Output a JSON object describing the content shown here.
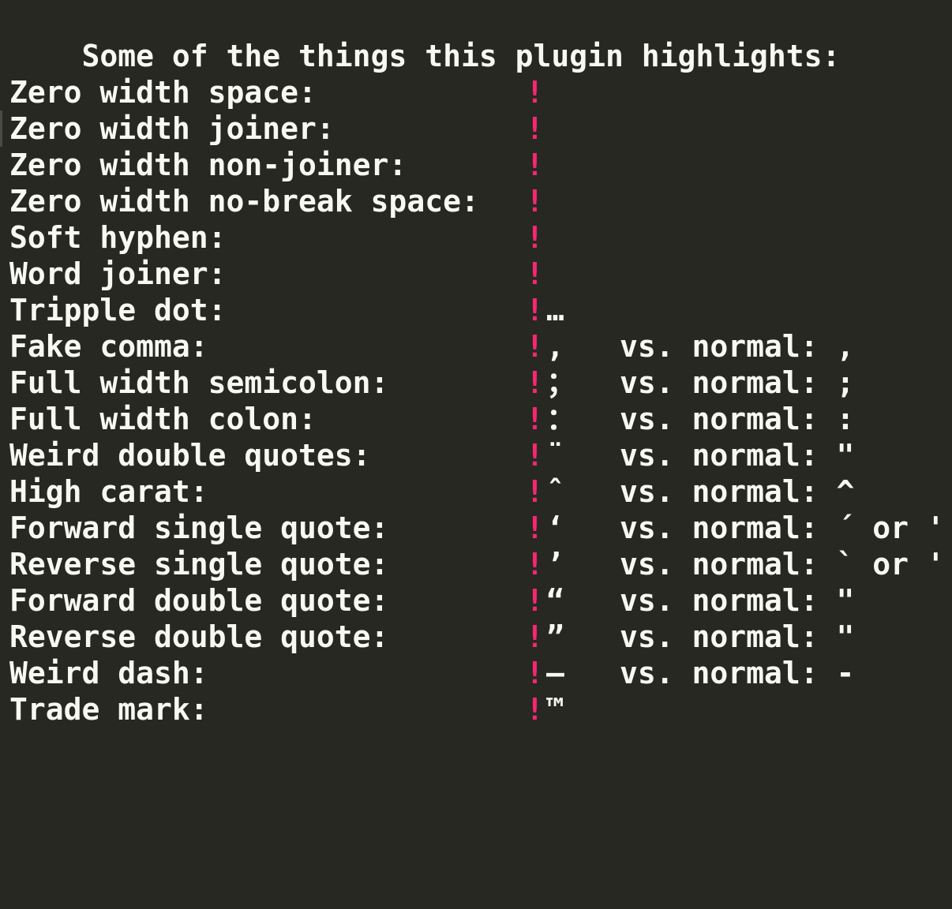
{
  "editor": {
    "heading": "Some of the things this plugin highlights:",
    "marker_color": "#f92672",
    "background_color": "#272822",
    "text_color": "#f8f8f2",
    "rows": [
      {
        "label": "Zero width space:",
        "marker": "!",
        "glyph": "",
        "compare": ""
      },
      {
        "label": "Zero width joiner:",
        "marker": "!",
        "glyph": "",
        "compare": ""
      },
      {
        "label": "Zero width non-joiner:",
        "marker": "!",
        "glyph": "",
        "compare": ""
      },
      {
        "label": "Zero width no-break space:",
        "marker": "!",
        "glyph": "",
        "compare": ""
      },
      {
        "label": "Soft hyphen:",
        "marker": "!",
        "glyph": "",
        "compare": ""
      },
      {
        "label": "Word joiner:",
        "marker": "!",
        "glyph": "",
        "compare": ""
      },
      {
        "label": "Tripple dot:",
        "marker": "!",
        "glyph": "…",
        "compare": ""
      },
      {
        "label": "Fake comma:",
        "marker": "!",
        "glyph": "‚",
        "compare": "vs. normal: ,"
      },
      {
        "label": "Full width semicolon:",
        "marker": "!",
        "glyph": "；",
        "compare": "vs. normal: ;"
      },
      {
        "label": "Full width colon:",
        "marker": "!",
        "glyph": "：",
        "compare": "vs. normal: :"
      },
      {
        "label": "Weird double quotes:",
        "marker": "!",
        "glyph": "¨",
        "compare": "vs. normal: \""
      },
      {
        "label": "High carat:",
        "marker": "!",
        "glyph": "ˆ",
        "compare": "vs. normal: ^"
      },
      {
        "label": "Forward single quote:",
        "marker": "!",
        "glyph": "‘",
        "compare": "vs. normal: ´ or '"
      },
      {
        "label": "Reverse single quote:",
        "marker": "!",
        "glyph": "’",
        "compare": "vs. normal: ` or '"
      },
      {
        "label": "Forward double quote:",
        "marker": "!",
        "glyph": "“",
        "compare": "vs. normal: \""
      },
      {
        "label": "Reverse double quote:",
        "marker": "!",
        "glyph": "”",
        "compare": "vs. normal: \""
      },
      {
        "label": "Weird dash:",
        "marker": "!",
        "glyph": "—",
        "compare": "vs. normal: -"
      },
      {
        "label": "Trade mark:",
        "marker": "!",
        "glyph": "™",
        "compare": ""
      }
    ]
  }
}
